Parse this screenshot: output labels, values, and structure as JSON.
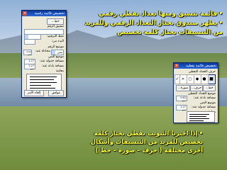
{
  "captions": {
    "top": [
      "قائمة تنسيق ومنها تعداد نقطي رقمي",
      "يظهر صندوق نختار التعداد الرقمي وللمزيد",
      "من التنسيقات نختار كلمة تخصيص"
    ],
    "bottom": [
      "إذا اخترنا التبويب نقطي نختار كلمة",
      "تخصيص للمزيد من التنسيقات وأشكال",
      "أخرى مختلفة ( حرف – صورة – خط )"
    ],
    "color": "#ffff33"
  },
  "dialog_numbered": {
    "title": "تخصيص قائمة رقمية",
    "ok": "موافق",
    "cancel": "إلغاء الأمر",
    "font_button": "خط...",
    "format_label": "تنسيق الرقم",
    "style_label": "نمط الترقيم:",
    "start_label": "البدء من:",
    "position_label": "موضع الرقم",
    "align_value": "يمين",
    "at_label": "محاذاة عند:",
    "at_value": "0.63 سم",
    "text_position_label": "موضع النص",
    "tab_label": "مسافة جدولة عند:",
    "tab_value": "1.27 سم",
    "indent_label": "مسافة بادئة عند:",
    "indent_value": "1.27 سم",
    "preview_label": "معاينة"
  },
  "dialog_bulleted": {
    "title": "تخصيص قائمة نقطية",
    "ok": "موافق",
    "cancel": "إلغاء الأمر",
    "char_label": "حرف التعداد النقطي",
    "font_button": "خط...",
    "char_button": "حرف...",
    "picture_button": "صورة...",
    "bullets": [
      "■",
      "●",
      "◆",
      "○",
      "➢",
      "✓"
    ],
    "position_label": "موضع التعداد النقطي",
    "indent_label": "مسافة بادئة عند:",
    "indent_value": "0.63 سم",
    "text_position_label": "موضع النص",
    "tab_label": "مسافة جدولة عند:",
    "tab_value": "1.27 سم",
    "preview_label": "معاينة"
  }
}
